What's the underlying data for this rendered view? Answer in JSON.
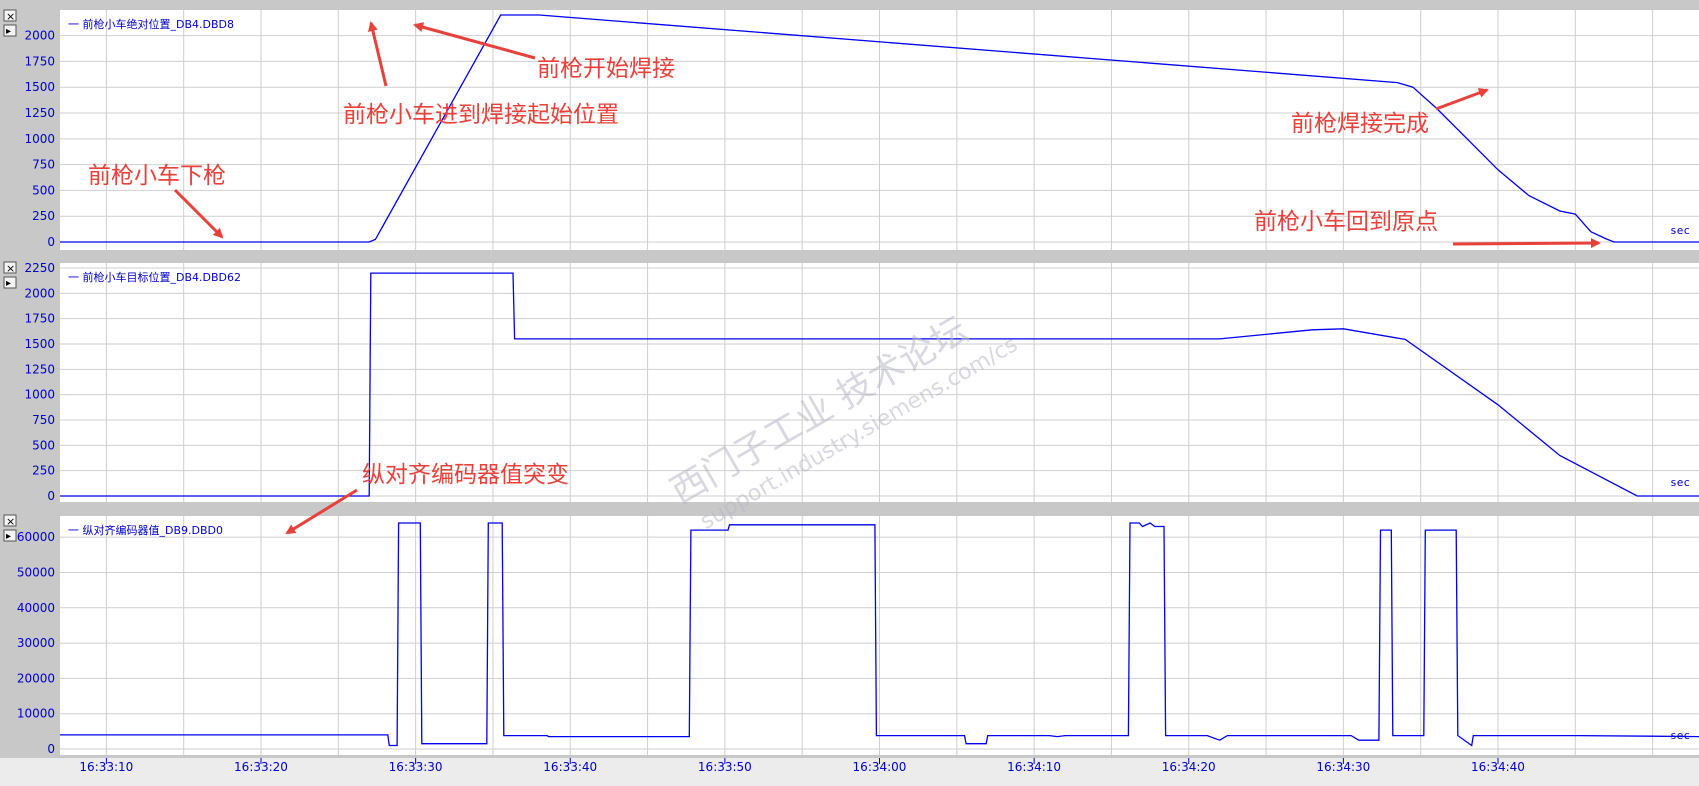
{
  "window": {
    "close_glyph": "×",
    "expand_glyph": "▸"
  },
  "watermark": {
    "cn": "西门子工业 技术论坛",
    "url": "support.industry.siemens.com/cs"
  },
  "time_axis": {
    "unit": "sec",
    "tick_labels": [
      "16:33:10",
      "16:33:20",
      "16:33:30",
      "16:33:40",
      "16:33:50",
      "16:34:00",
      "16:34:10",
      "16:34:20",
      "16:34:30",
      "16:34:40"
    ],
    "range_sec": [
      -3,
      103
    ]
  },
  "colors": {
    "trace": "#0000ee",
    "annotation": "#e8403a",
    "grid": "#cfcfcf",
    "panel_bg": "#ffffff",
    "frame_bg": "#c8c8c8"
  },
  "chart_data": [
    {
      "type": "line",
      "series": [
        {
          "name": "一 前枪小车绝对位置_DB4.DBD8",
          "x": [
            -3,
            17,
            17.4,
            25.5,
            28,
            83.5,
            84.5,
            86,
            88,
            90,
            92,
            94,
            95,
            96,
            97,
            97.5,
            98.5,
            103
          ],
          "y": [
            0,
            0,
            25,
            2200,
            2200,
            1545,
            1500,
            1300,
            1000,
            700,
            450,
            300,
            270,
            100,
            30,
            0,
            0,
            0
          ]
        }
      ],
      "ylim": [
        0,
        2200
      ],
      "yticks": [
        0,
        250,
        500,
        750,
        1000,
        1250,
        1500,
        1750,
        2000
      ],
      "annotations": [
        {
          "text": "前枪开始焊接"
        },
        {
          "text": "前枪小车进到焊接起始位置"
        },
        {
          "text": "前枪小车下枪"
        },
        {
          "text": "前枪焊接完成"
        },
        {
          "text": "前枪小车回到原点"
        }
      ]
    },
    {
      "type": "line",
      "series": [
        {
          "name": "一 前枪小车目标位置_DB4.DBD62",
          "x": [
            -3,
            17,
            17.1,
            26.3,
            26.4,
            32,
            42,
            52,
            62,
            72,
            78,
            80,
            84,
            90,
            94,
            99,
            103
          ],
          "y": [
            0,
            0,
            2200,
            2200,
            1550,
            1550,
            1550,
            1550,
            1550,
            1550,
            1640,
            1650,
            1545,
            900,
            400,
            0,
            0
          ]
        }
      ],
      "ylim": [
        0,
        2250
      ],
      "yticks": [
        0,
        250,
        500,
        750,
        1000,
        1250,
        1500,
        1750,
        2000,
        2250
      ]
    },
    {
      "type": "line",
      "series": [
        {
          "name": "一 纵对齐编码器值_DB9.DBD0",
          "x": [
            -3,
            18.2,
            18.3,
            18.8,
            18.9,
            20.3,
            20.4,
            24.6,
            24.7,
            25.6,
            25.7,
            28.5,
            28.6,
            37.7,
            37.8,
            40.2,
            40.3,
            49.7,
            49.8,
            55.5,
            55.6,
            56.9,
            57.0,
            61,
            61.5,
            62,
            62.5,
            63,
            66.1,
            66.2,
            66.8,
            67,
            67.5,
            67.8,
            68.4,
            68.5,
            69.7,
            69.8,
            71.2,
            72,
            72.5,
            73.5,
            76,
            77,
            78,
            78.2,
            80.5,
            81,
            82.3,
            82.4,
            83.1,
            83.2,
            84,
            85.2,
            85.3,
            87.3,
            87.4,
            88.3,
            88.4,
            89.8,
            89.9,
            93,
            95,
            95.2,
            103
          ],
          "y": [
            4000,
            4000,
            1000,
            1000,
            64000,
            64000,
            1500,
            1500,
            64000,
            64000,
            3800,
            3800,
            3500,
            3500,
            62000,
            62000,
            63500,
            63500,
            3800,
            3800,
            1500,
            1500,
            3800,
            3800,
            3500,
            3800,
            3800,
            3800,
            3800,
            64000,
            64000,
            63000,
            64000,
            63000,
            63000,
            3800,
            3800,
            3800,
            3800,
            2500,
            3800,
            3800,
            3800,
            3800,
            3800,
            3800,
            3800,
            2500,
            2500,
            62000,
            62000,
            3800,
            3800,
            3800,
            62000,
            62000,
            3800,
            1000,
            3800,
            3800,
            3800,
            3800,
            3800,
            3800,
            3500
          ],
          "tick_note": "segments between"
        }
      ],
      "ylim": [
        0,
        64000
      ],
      "yticks": [
        0,
        10000,
        20000,
        30000,
        40000,
        50000,
        60000
      ],
      "annotations": [
        {
          "text": "纵对齐编码器值突变"
        }
      ]
    }
  ]
}
